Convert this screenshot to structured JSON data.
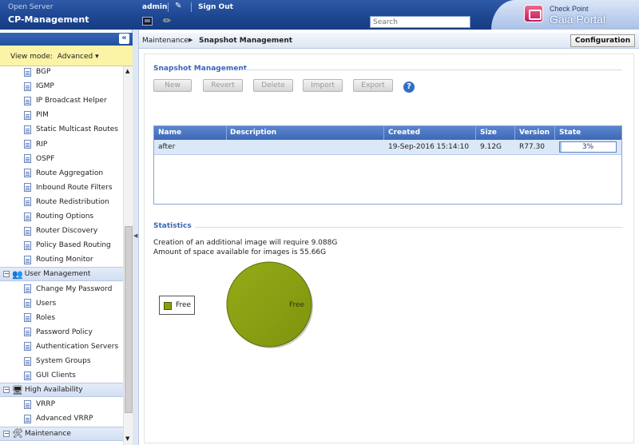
{
  "header": {
    "product": "Open Server",
    "host": "CP-Management",
    "user": "admin",
    "sign_out": "Sign Out",
    "search_placeholder": "Search",
    "brand_line1": "Check Point",
    "brand_line2": "Gaia Portal"
  },
  "sidebar": {
    "view_mode_label": "View mode:",
    "view_mode_value": "Advanced ▾",
    "items": [
      {
        "label": "BGP",
        "type": "item"
      },
      {
        "label": "IGMP",
        "type": "item"
      },
      {
        "label": "IP Broadcast Helper",
        "type": "item"
      },
      {
        "label": "PIM",
        "type": "item"
      },
      {
        "label": "Static Multicast Routes",
        "type": "item"
      },
      {
        "label": "RIP",
        "type": "item"
      },
      {
        "label": "OSPF",
        "type": "item"
      },
      {
        "label": "Route Aggregation",
        "type": "item"
      },
      {
        "label": "Inbound Route Filters",
        "type": "item"
      },
      {
        "label": "Route Redistribution",
        "type": "item"
      },
      {
        "label": "Routing Options",
        "type": "item"
      },
      {
        "label": "Router Discovery",
        "type": "item"
      },
      {
        "label": "Policy Based Routing",
        "type": "item"
      },
      {
        "label": "Routing Monitor",
        "type": "item"
      },
      {
        "label": "User Management",
        "type": "group",
        "icon": "users-icon"
      },
      {
        "label": "Change My Password",
        "type": "item"
      },
      {
        "label": "Users",
        "type": "item"
      },
      {
        "label": "Roles",
        "type": "item"
      },
      {
        "label": "Password Policy",
        "type": "item"
      },
      {
        "label": "Authentication Servers",
        "type": "item"
      },
      {
        "label": "System Groups",
        "type": "item"
      },
      {
        "label": "GUI Clients",
        "type": "item"
      },
      {
        "label": "High Availability",
        "type": "group",
        "icon": "monitor-icon"
      },
      {
        "label": "VRRP",
        "type": "item"
      },
      {
        "label": "Advanced VRRP",
        "type": "item"
      },
      {
        "label": "Maintenance",
        "type": "group",
        "icon": "tools-icon"
      }
    ]
  },
  "breadcrumb": {
    "parent": "Maintenance",
    "current": "Snapshot Management",
    "configuration_button": "Configuration"
  },
  "snapshot": {
    "title": "Snapshot Management",
    "buttons": {
      "new": "New",
      "revert": "Revert",
      "delete": "Delete",
      "import": "Import",
      "export": "Export"
    },
    "help": "?",
    "columns": [
      "Name",
      "Description",
      "Created",
      "Size",
      "Version",
      "State"
    ],
    "rows": [
      {
        "name": "after",
        "description": "",
        "created": "19-Sep-2016 15:14:10",
        "size": "9.12G",
        "version": "R77.30",
        "state_text": "3%",
        "state_progress": 0.03
      }
    ]
  },
  "statistics": {
    "title": "Statistics",
    "line1": "Creation of an additional image will require 9.088G",
    "line2": "Amount of space available for images is 55.66G",
    "legend_free": "Free",
    "pie_label": "Free",
    "pie_color": "#8a9f12"
  },
  "chart_data": {
    "type": "pie",
    "categories": [
      "Free"
    ],
    "values": [
      100
    ],
    "title": "",
    "legend": "left"
  }
}
